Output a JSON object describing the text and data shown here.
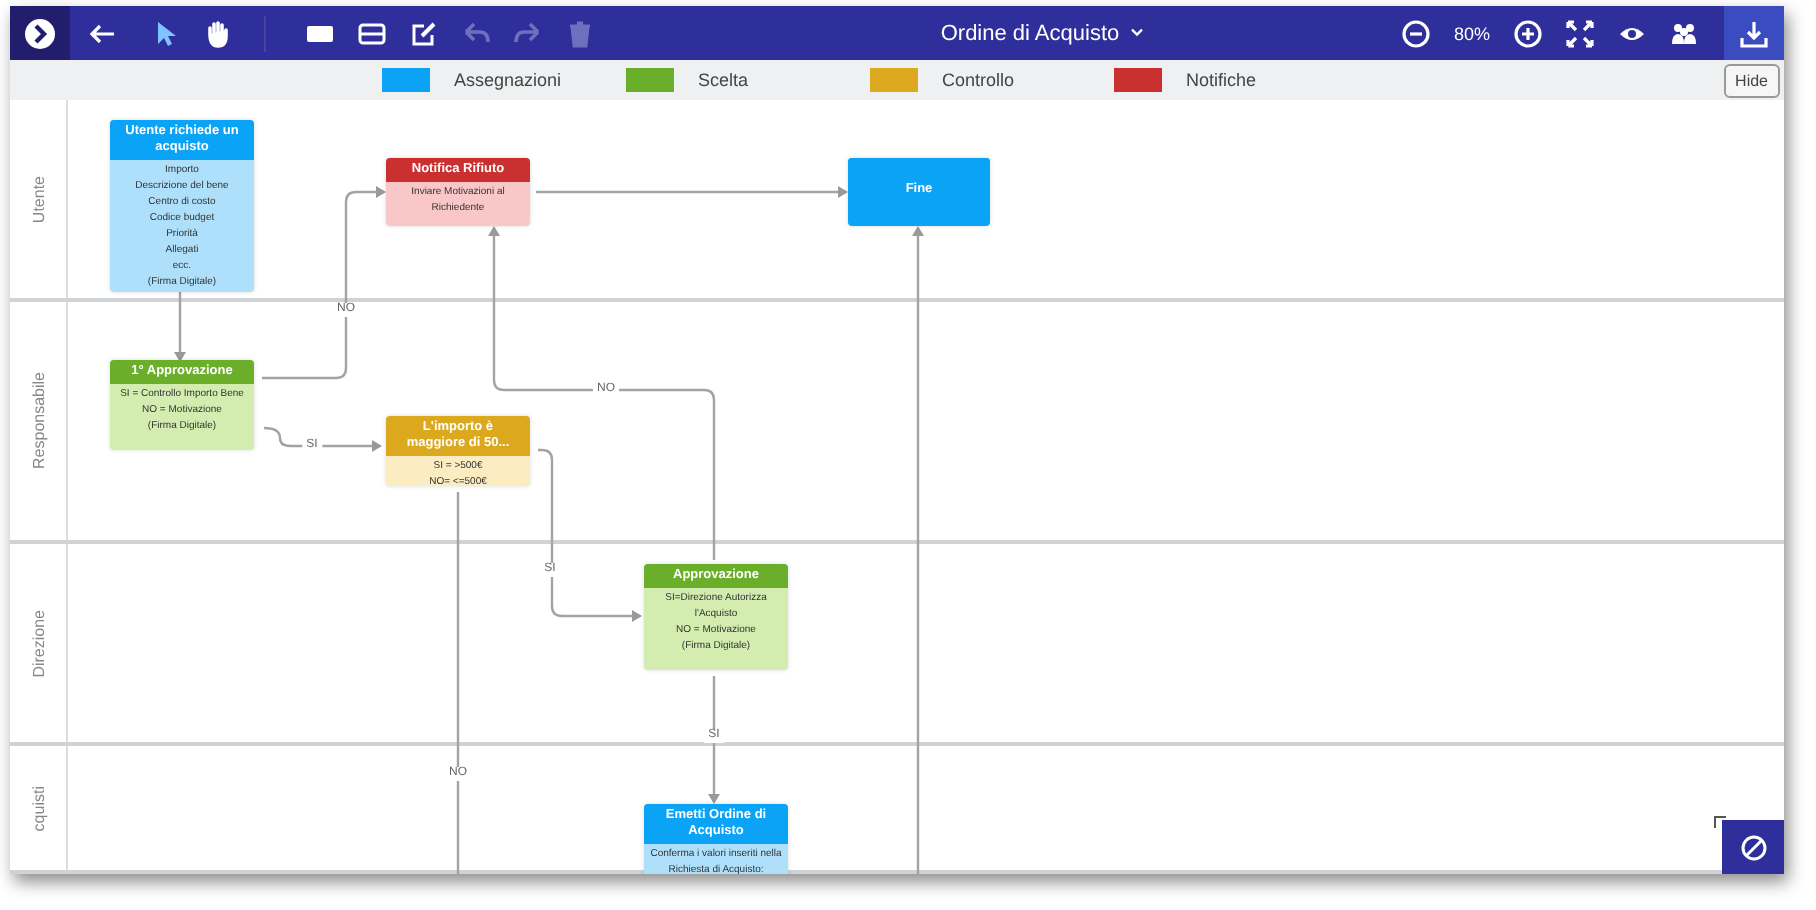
{
  "toolbar": {
    "title": "Ordine di Acquisto",
    "zoom": "80%",
    "modes": [
      {
        "kind": "pointer",
        "selected": true
      },
      {
        "kind": "hand",
        "selected": false
      }
    ],
    "tools": [
      {
        "kind": "rectangle",
        "disabled": false
      },
      {
        "kind": "lane",
        "disabled": false
      },
      {
        "kind": "edit",
        "disabled": false
      },
      {
        "kind": "undo",
        "disabled": true
      },
      {
        "kind": "redo",
        "disabled": true
      },
      {
        "kind": "trash",
        "disabled": true
      }
    ]
  },
  "legend": {
    "items": [
      {
        "label": "Assegnazioni",
        "color": "#0aa3f5"
      },
      {
        "label": "Scelta",
        "color": "#6aae2a"
      },
      {
        "label": "Controllo",
        "color": "#dca91e"
      },
      {
        "label": "Notifiche",
        "color": "#c9302f"
      }
    ],
    "hide_button": "Hide"
  },
  "lanes": [
    "Utente",
    "Responsabile",
    "Direzione",
    "cquisti"
  ],
  "nodes": [
    {
      "kind": "assignment",
      "title": "Utente richiede un acquisto",
      "lines": [
        "Importo",
        "Descrizione del bene",
        "Centro di costo",
        "Codice budget",
        "Priorità",
        "Allegati",
        "ecc.",
        "(Firma Digitale)"
      ]
    },
    {
      "kind": "notification",
      "title": "Notifica Rifiuto",
      "lines": [
        "Inviare Motivazioni al Richiedente"
      ]
    },
    {
      "kind": "assignment",
      "title": "Fine"
    },
    {
      "kind": "choice",
      "title": "1° Approvazione",
      "lines": [
        "SI = Controllo Importo Bene",
        "NO = Motivazione",
        "(Firma Digitale)"
      ]
    },
    {
      "kind": "check",
      "title": "L'importo è maggiore di 50...",
      "lines": [
        "SI = >500€",
        "NO= <=500€"
      ]
    },
    {
      "kind": "choice",
      "title": "Approvazione",
      "lines": [
        "SI=Direzione Autorizza l'Acquisto",
        "NO = Motivazione",
        "(Firma Digitale)"
      ]
    },
    {
      "kind": "assignment",
      "title": "Emetti Ordine di Acquisto",
      "lines": [
        "Conferma i valori inseriti nella Richiesta di Acquisto:"
      ]
    }
  ],
  "edges": [
    {
      "arrow": true
    },
    {
      "arrow": true,
      "label": "NO"
    },
    {
      "arrow": true,
      "label": "SI"
    },
    {
      "arrow": true
    },
    {
      "arrow": true,
      "label": "NO"
    },
    {
      "arrow": true,
      "label": "SI"
    },
    {
      "arrow": false,
      "label": "NO"
    },
    {
      "arrow": true,
      "label": "SI"
    },
    {
      "arrow": true
    }
  ]
}
